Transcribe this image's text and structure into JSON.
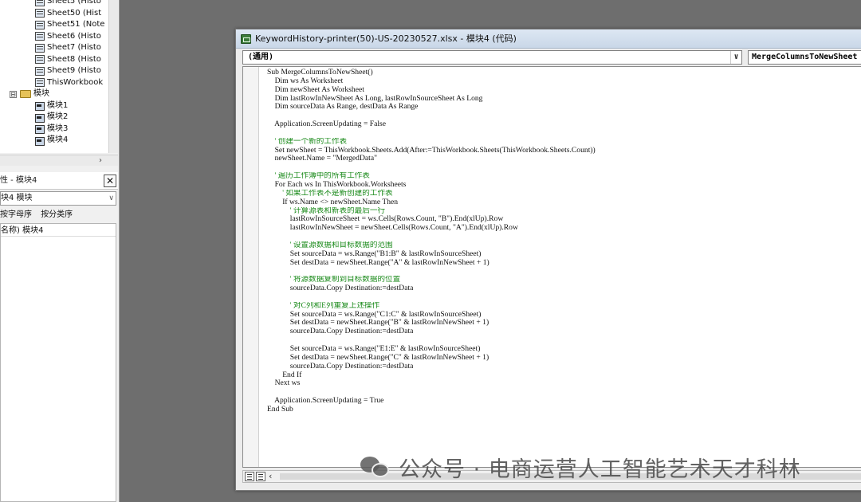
{
  "project_tree": {
    "nodes": [
      {
        "label": "Sheet5 (Histo",
        "kind": "sheet"
      },
      {
        "label": "Sheet50 (Hist",
        "kind": "sheet"
      },
      {
        "label": "Sheet51 (Note",
        "kind": "sheet"
      },
      {
        "label": "Sheet6 (Histo",
        "kind": "sheet"
      },
      {
        "label": "Sheet7 (Histo",
        "kind": "sheet"
      },
      {
        "label": "Sheet8 (Histo",
        "kind": "sheet"
      },
      {
        "label": "Sheet9 (Histo",
        "kind": "sheet"
      },
      {
        "label": "ThisWorkbook",
        "kind": "workbook"
      },
      {
        "label": "模块",
        "kind": "folder",
        "expander": "⊟"
      },
      {
        "label": "模块1",
        "kind": "module"
      },
      {
        "label": "模块2",
        "kind": "module"
      },
      {
        "label": "模块3",
        "kind": "module"
      },
      {
        "label": "模块4",
        "kind": "module"
      }
    ],
    "hscroll_arrow": "›"
  },
  "properties": {
    "title": "性 - 模块4",
    "close_label": "✕",
    "object_select": "块4 模块",
    "tab_alpha": "按字母序",
    "tab_category": "按分类序",
    "row_name": "名称) 模块4"
  },
  "code_window": {
    "title": "KeywordHistory-printer(50)-US-20230527.xlsx - 模块4 (代码)",
    "object_dropdown": "(通用)",
    "proc_dropdown": "MergeColumnsToNewSheet",
    "code_lines": [
      {
        "t": "Sub MergeColumnsToNewSheet()",
        "c": false
      },
      {
        "t": "    Dim ws As Worksheet",
        "c": false
      },
      {
        "t": "    Dim newSheet As Worksheet",
        "c": false
      },
      {
        "t": "    Dim lastRowInNewSheet As Long, lastRowInSourceSheet As Long",
        "c": false
      },
      {
        "t": "    Dim sourceData As Range, destData As Range",
        "c": false
      },
      {
        "t": "",
        "c": false
      },
      {
        "t": "    Application.ScreenUpdating = False",
        "c": false
      },
      {
        "t": "",
        "c": false
      },
      {
        "t": "    ' 创建一个新的工作表",
        "c": true
      },
      {
        "t": "    Set newSheet = ThisWorkbook.Sheets.Add(After:=ThisWorkbook.Sheets(ThisWorkbook.Sheets.Count))",
        "c": false
      },
      {
        "t": "    newSheet.Name = \"MergedData\"",
        "c": false
      },
      {
        "t": "",
        "c": false
      },
      {
        "t": "    ' 遍历工作簿中的所有工作表",
        "c": true
      },
      {
        "t": "    For Each ws In ThisWorkbook.Worksheets",
        "c": false
      },
      {
        "t": "        ' 如果工作表不是新创建的工作表",
        "c": true
      },
      {
        "t": "        If ws.Name <> newSheet.Name Then",
        "c": false
      },
      {
        "t": "            ' 计算源表和新表的最后一行",
        "c": true
      },
      {
        "t": "            lastRowInSourceSheet = ws.Cells(Rows.Count, \"B\").End(xlUp).Row",
        "c": false
      },
      {
        "t": "            lastRowInNewSheet = newSheet.Cells(Rows.Count, \"A\").End(xlUp).Row",
        "c": false
      },
      {
        "t": "",
        "c": false
      },
      {
        "t": "            ' 设置源数据和目标数据的范围",
        "c": true
      },
      {
        "t": "            Set sourceData = ws.Range(\"B1:B\" & lastRowInSourceSheet)",
        "c": false
      },
      {
        "t": "            Set destData = newSheet.Range(\"A\" & lastRowInNewSheet + 1)",
        "c": false
      },
      {
        "t": "",
        "c": false
      },
      {
        "t": "            ' 将源数据复制到目标数据的位置",
        "c": true
      },
      {
        "t": "            sourceData.Copy Destination:=destData",
        "c": false
      },
      {
        "t": "",
        "c": false
      },
      {
        "t": "            ' 对C列和E列重复上述操作",
        "c": true
      },
      {
        "t": "            Set sourceData = ws.Range(\"C1:C\" & lastRowInSourceSheet)",
        "c": false
      },
      {
        "t": "            Set destData = newSheet.Range(\"B\" & lastRowInNewSheet + 1)",
        "c": false
      },
      {
        "t": "            sourceData.Copy Destination:=destData",
        "c": false
      },
      {
        "t": "",
        "c": false
      },
      {
        "t": "            Set sourceData = ws.Range(\"E1:E\" & lastRowInSourceSheet)",
        "c": false
      },
      {
        "t": "            Set destData = newSheet.Range(\"C\" & lastRowInNewSheet + 1)",
        "c": false
      },
      {
        "t": "            sourceData.Copy Destination:=destData",
        "c": false
      },
      {
        "t": "        End If",
        "c": false
      },
      {
        "t": "    Next ws",
        "c": false
      },
      {
        "t": "",
        "c": false
      },
      {
        "t": "    Application.ScreenUpdating = True",
        "c": false
      },
      {
        "t": "End Sub",
        "c": false
      }
    ],
    "dropdown_arrow": "∨",
    "hscroll_left_arrow": "‹"
  },
  "watermark": {
    "text": "公众号 · 电商运营人工智能艺术天才科林",
    "icon": "wechat-icon"
  },
  "colors": {
    "comment": "#1a8a1a",
    "code": "#111111",
    "folder": "#e6c35a"
  }
}
